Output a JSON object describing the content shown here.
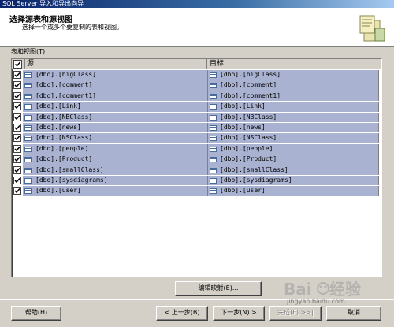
{
  "window": {
    "title": "SQL Server 导入和导出向导"
  },
  "header": {
    "title": "选择源表和源视图",
    "subtitle": "选择一个或多个要复制的表和视图。"
  },
  "grid": {
    "label": "表和视图(T):",
    "columns": {
      "source": "源",
      "destination": "目标"
    },
    "rows": [
      {
        "source": "[dbo].[bigClass]",
        "destination": "[dbo].[bigClass]",
        "checked": true
      },
      {
        "source": "[dbo].[comment]",
        "destination": "[dbo].[comment]",
        "checked": true
      },
      {
        "source": "[dbo].[comment1]",
        "destination": "[dbo].[comment1]",
        "checked": true
      },
      {
        "source": "[dbo].[Link]",
        "destination": "[dbo].[Link]",
        "checked": true
      },
      {
        "source": "[dbo].[NBClass]",
        "destination": "[dbo].[NBClass]",
        "checked": true
      },
      {
        "source": "[dbo].[news]",
        "destination": "[dbo].[news]",
        "checked": true
      },
      {
        "source": "[dbo].[NSClass]",
        "destination": "[dbo].[NSClass]",
        "checked": true
      },
      {
        "source": "[dbo].[people]",
        "destination": "[dbo].[people]",
        "checked": true
      },
      {
        "source": "[dbo].[Product]",
        "destination": "[dbo].[Product]",
        "checked": true
      },
      {
        "source": "[dbo].[smallClass]",
        "destination": "[dbo].[smallClass]",
        "checked": true
      },
      {
        "source": "[dbo].[sysdiagrams]",
        "destination": "[dbo].[sysdiagrams]",
        "checked": true
      },
      {
        "source": "[dbo].[user]",
        "destination": "[dbo].[user]",
        "checked": true
      }
    ]
  },
  "buttons": {
    "edit_mappings": "编辑映射(E)...",
    "help": "帮助(H)",
    "back": "< 上一步(B)",
    "next": "下一步(N) >",
    "finish": "完成(F) >>|",
    "cancel": "取消"
  },
  "watermark": {
    "text": "jingyan.baidu.com"
  },
  "colors": {
    "selection": "#a9b2d1",
    "face": "#d4d0c8",
    "titlebar": "#0a246a"
  }
}
